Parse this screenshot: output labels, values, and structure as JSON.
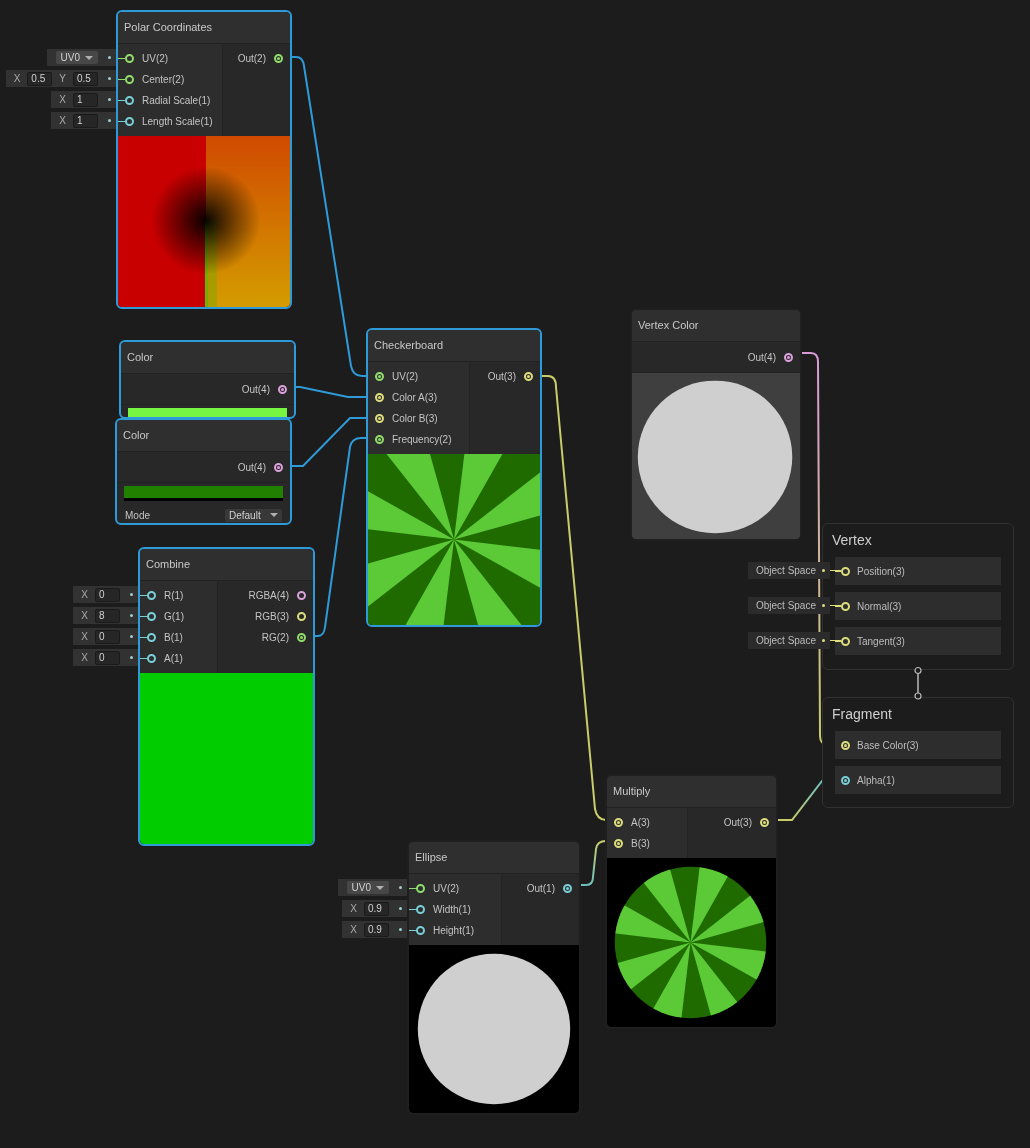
{
  "nodes": [
    {
      "title": "Polar Coordinates",
      "selected": true,
      "inputs": [
        {
          "label": "UV(2)",
          "color": "#8fdc6a",
          "connected": false,
          "control": {
            "kind": "dropdown",
            "value": "UV0"
          }
        },
        {
          "label": "Center(2)",
          "color": "#8fdc6a",
          "connected": false,
          "control": {
            "kind": "vector",
            "fields": [
              {
                "axis": "X",
                "value": "0.5"
              },
              {
                "axis": "Y",
                "value": "0.5"
              }
            ]
          }
        },
        {
          "label": "Radial Scale(1)",
          "color": "#78cfd6",
          "connected": false,
          "control": {
            "kind": "vector",
            "fields": [
              {
                "axis": "X",
                "value": "1"
              }
            ]
          }
        },
        {
          "label": "Length Scale(1)",
          "color": "#78cfd6",
          "connected": false,
          "control": {
            "kind": "vector",
            "fields": [
              {
                "axis": "X",
                "value": "1"
              }
            ]
          }
        }
      ],
      "outputs": [
        {
          "label": "Out(2)",
          "color": "#8fdc6a",
          "connected": true
        }
      ],
      "preview": {
        "kind": "polar"
      }
    },
    {
      "title": "Color",
      "selected": true,
      "outputs": [
        {
          "label": "Out(4)",
          "color": "#dca0dc",
          "connected": true
        }
      ],
      "swatch": {
        "color": "#76f542"
      }
    },
    {
      "title": "Color",
      "selected": true,
      "outputs": [
        {
          "label": "Out(4)",
          "color": "#dca0dc",
          "connected": true
        }
      ],
      "swatch": {
        "color": "#228000"
      },
      "mode": {
        "label": "Mode",
        "value": "Default"
      }
    },
    {
      "title": "Checkerboard",
      "selected": true,
      "inputs": [
        {
          "label": "UV(2)",
          "color": "#8fdc6a",
          "connected": true
        },
        {
          "label": "Color A(3)",
          "color": "#dcdc7c",
          "connected": true
        },
        {
          "label": "Color B(3)",
          "color": "#dcdc7c",
          "connected": true
        },
        {
          "label": "Frequency(2)",
          "color": "#8fdc6a",
          "connected": true
        }
      ],
      "outputs": [
        {
          "label": "Out(3)",
          "color": "#dcdc7c",
          "connected": true
        }
      ],
      "preview": {
        "kind": "rays"
      }
    },
    {
      "title": "Combine",
      "selected": true,
      "inputs": [
        {
          "label": "R(1)",
          "color": "#78cfd6",
          "connected": false,
          "control": {
            "kind": "vector",
            "fields": [
              {
                "axis": "X",
                "value": "0"
              }
            ]
          }
        },
        {
          "label": "G(1)",
          "color": "#78cfd6",
          "connected": false,
          "control": {
            "kind": "vector",
            "fields": [
              {
                "axis": "X",
                "value": "8"
              }
            ]
          }
        },
        {
          "label": "B(1)",
          "color": "#78cfd6",
          "connected": false,
          "control": {
            "kind": "vector",
            "fields": [
              {
                "axis": "X",
                "value": "0"
              }
            ]
          }
        },
        {
          "label": "A(1)",
          "color": "#78cfd6",
          "connected": false,
          "control": {
            "kind": "vector",
            "fields": [
              {
                "axis": "X",
                "value": "0"
              }
            ]
          }
        }
      ],
      "outputs": [
        {
          "label": "RGBA(4)",
          "color": "#dca0dc",
          "connected": false
        },
        {
          "label": "RGB(3)",
          "color": "#dcdc7c",
          "connected": false
        },
        {
          "label": "RG(2)",
          "color": "#8fdc6a",
          "connected": true
        }
      ],
      "preview": {
        "kind": "solid"
      }
    },
    {
      "title": "Vertex Color",
      "selected": false,
      "outputs": [
        {
          "label": "Out(4)",
          "color": "#dca0dc",
          "connected": true
        }
      ],
      "preview": {
        "kind": "disc-gray"
      }
    },
    {
      "title": "Multiply",
      "selected": false,
      "inputs": [
        {
          "label": "A(3)",
          "color": "#dcdc7c",
          "connected": true
        },
        {
          "label": "B(3)",
          "color": "#dcdc7c",
          "connected": true
        }
      ],
      "outputs": [
        {
          "label": "Out(3)",
          "color": "#dcdc7c",
          "connected": true
        }
      ],
      "preview": {
        "kind": "rays-disc"
      }
    },
    {
      "title": "Ellipse",
      "selected": false,
      "inputs": [
        {
          "label": "UV(2)",
          "color": "#8fdc6a",
          "connected": false,
          "control": {
            "kind": "dropdown",
            "value": "UV0"
          }
        },
        {
          "label": "Width(1)",
          "color": "#78cfd6",
          "connected": false,
          "control": {
            "kind": "vector",
            "fields": [
              {
                "axis": "X",
                "value": "0.9"
              }
            ]
          }
        },
        {
          "label": "Height(1)",
          "color": "#78cfd6",
          "connected": false,
          "control": {
            "kind": "vector",
            "fields": [
              {
                "axis": "X",
                "value": "0.9"
              }
            ]
          }
        }
      ],
      "outputs": [
        {
          "label": "Out(1)",
          "color": "#78cfd6",
          "connected": true
        }
      ],
      "preview": {
        "kind": "disc-black"
      }
    }
  ],
  "stack": [
    {
      "title": "Vertex",
      "slots": [
        {
          "label": "Position(3)",
          "color": "#dcdc7c",
          "connected": false,
          "space": "Object Space"
        },
        {
          "label": "Normal(3)",
          "color": "#dcdc7c",
          "connected": false,
          "space": "Object Space"
        },
        {
          "label": "Tangent(3)",
          "color": "#dcdc7c",
          "connected": false,
          "space": "Object Space"
        }
      ]
    },
    {
      "title": "Fragment",
      "slots": [
        {
          "label": "Base Color(3)",
          "color": "#dcdc7c",
          "connected": true
        },
        {
          "label": "Alpha(1)",
          "color": "#78cfd6",
          "connected": true
        }
      ]
    }
  ]
}
